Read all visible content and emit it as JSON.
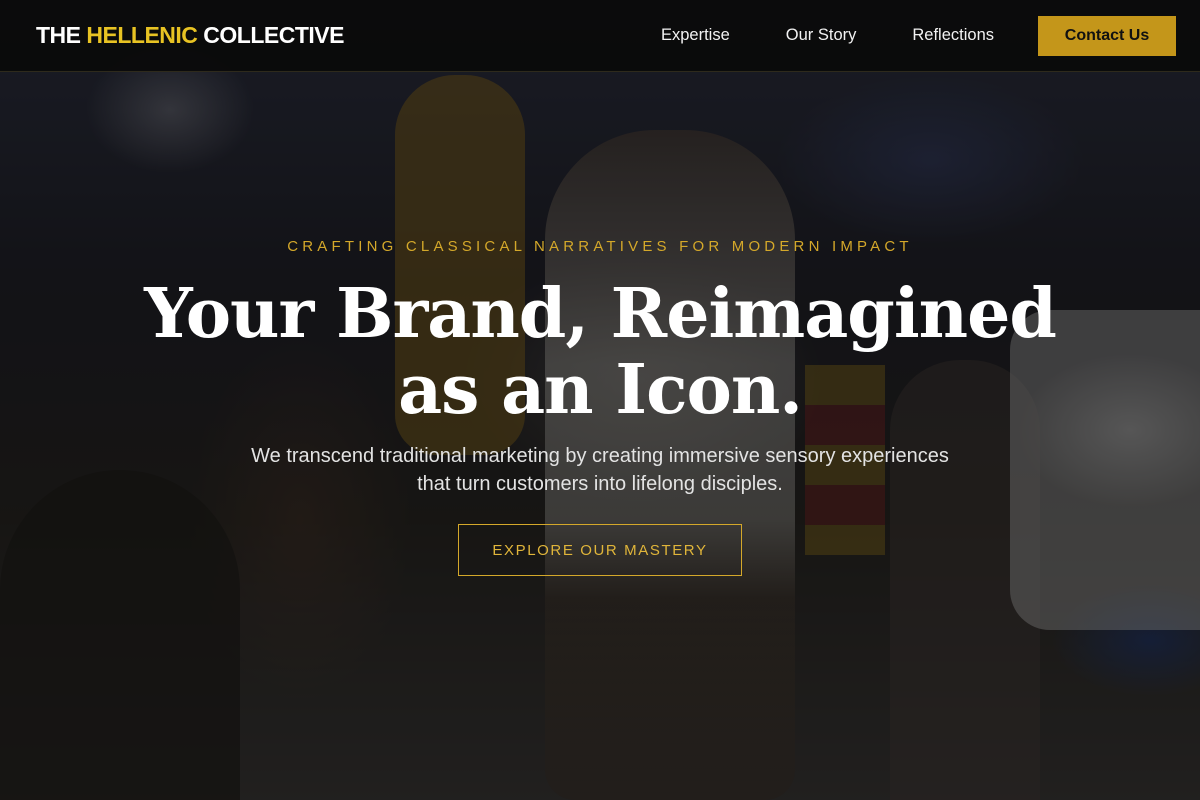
{
  "header": {
    "logo": {
      "part1": "THE ",
      "accent": "HELLENIC",
      "part2": " COLLECTIVE"
    },
    "nav": [
      {
        "label": "Expertise"
      },
      {
        "label": "Our Story"
      },
      {
        "label": "Reflections"
      }
    ],
    "contact_label": "Contact Us"
  },
  "hero": {
    "eyebrow": "CRAFTING CLASSICAL NARRATIVES FOR MODERN IMPACT",
    "headline_line1": "Your Brand, Reimagined",
    "headline_line2": "as an Icon.",
    "subtitle": "We transcend traditional marketing by creating immersive sensory experiences that turn customers into lifelong disciples.",
    "cta_label": "EXPLORE OUR MASTERY"
  },
  "colors": {
    "accent_gold": "#d4a82a",
    "button_gold": "#c4961a",
    "logo_yellow": "#e8c323",
    "header_bg": "#0a0a0a"
  }
}
